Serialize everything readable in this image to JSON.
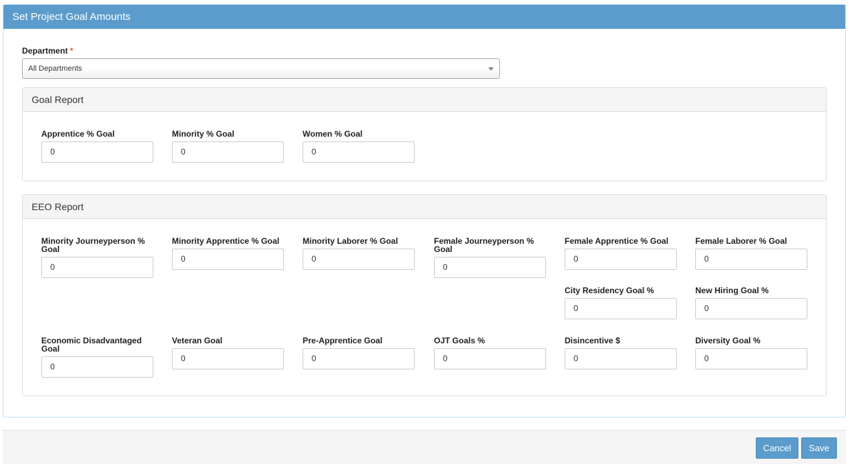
{
  "header": {
    "title": "Set Project Goal Amounts"
  },
  "department": {
    "label": "Department",
    "required_mark": "*",
    "selected": "All Departments"
  },
  "goal_report": {
    "title": "Goal Report",
    "fields": [
      {
        "label": "Apprentice % Goal",
        "value": "0"
      },
      {
        "label": "Minority % Goal",
        "value": "0"
      },
      {
        "label": "Women % Goal",
        "value": "0"
      }
    ]
  },
  "eeo_report": {
    "title": "EEO Report",
    "fields": [
      {
        "label": "Minority Journeyperson % Goal",
        "value": "0"
      },
      {
        "label": "Minority Apprentice % Goal",
        "value": "0"
      },
      {
        "label": "Minority Laborer % Goal",
        "value": "0"
      },
      {
        "label": "Female Journeyperson % Goal",
        "value": "0"
      },
      {
        "label": "Female Apprentice % Goal",
        "value": "0"
      },
      {
        "label": "Female Laborer % Goal",
        "value": "0"
      },
      {
        "label": "City Residency Goal %",
        "value": "0"
      },
      {
        "label": "New Hiring Goal %",
        "value": "0"
      },
      {
        "label": "Economic Disadvantaged Goal",
        "value": "0"
      },
      {
        "label": "Veteran Goal",
        "value": "0"
      },
      {
        "label": "Pre-Apprentice Goal",
        "value": "0"
      },
      {
        "label": "OJT Goals %",
        "value": "0"
      },
      {
        "label": "Disincentive $",
        "value": "0"
      },
      {
        "label": "Diversity Goal %",
        "value": "0"
      }
    ]
  },
  "footer": {
    "cancel_label": "Cancel",
    "save_label": "Save"
  },
  "colors": {
    "header": "#5b9ccc",
    "button": "#5b9ccc",
    "required": "#d9534f"
  }
}
